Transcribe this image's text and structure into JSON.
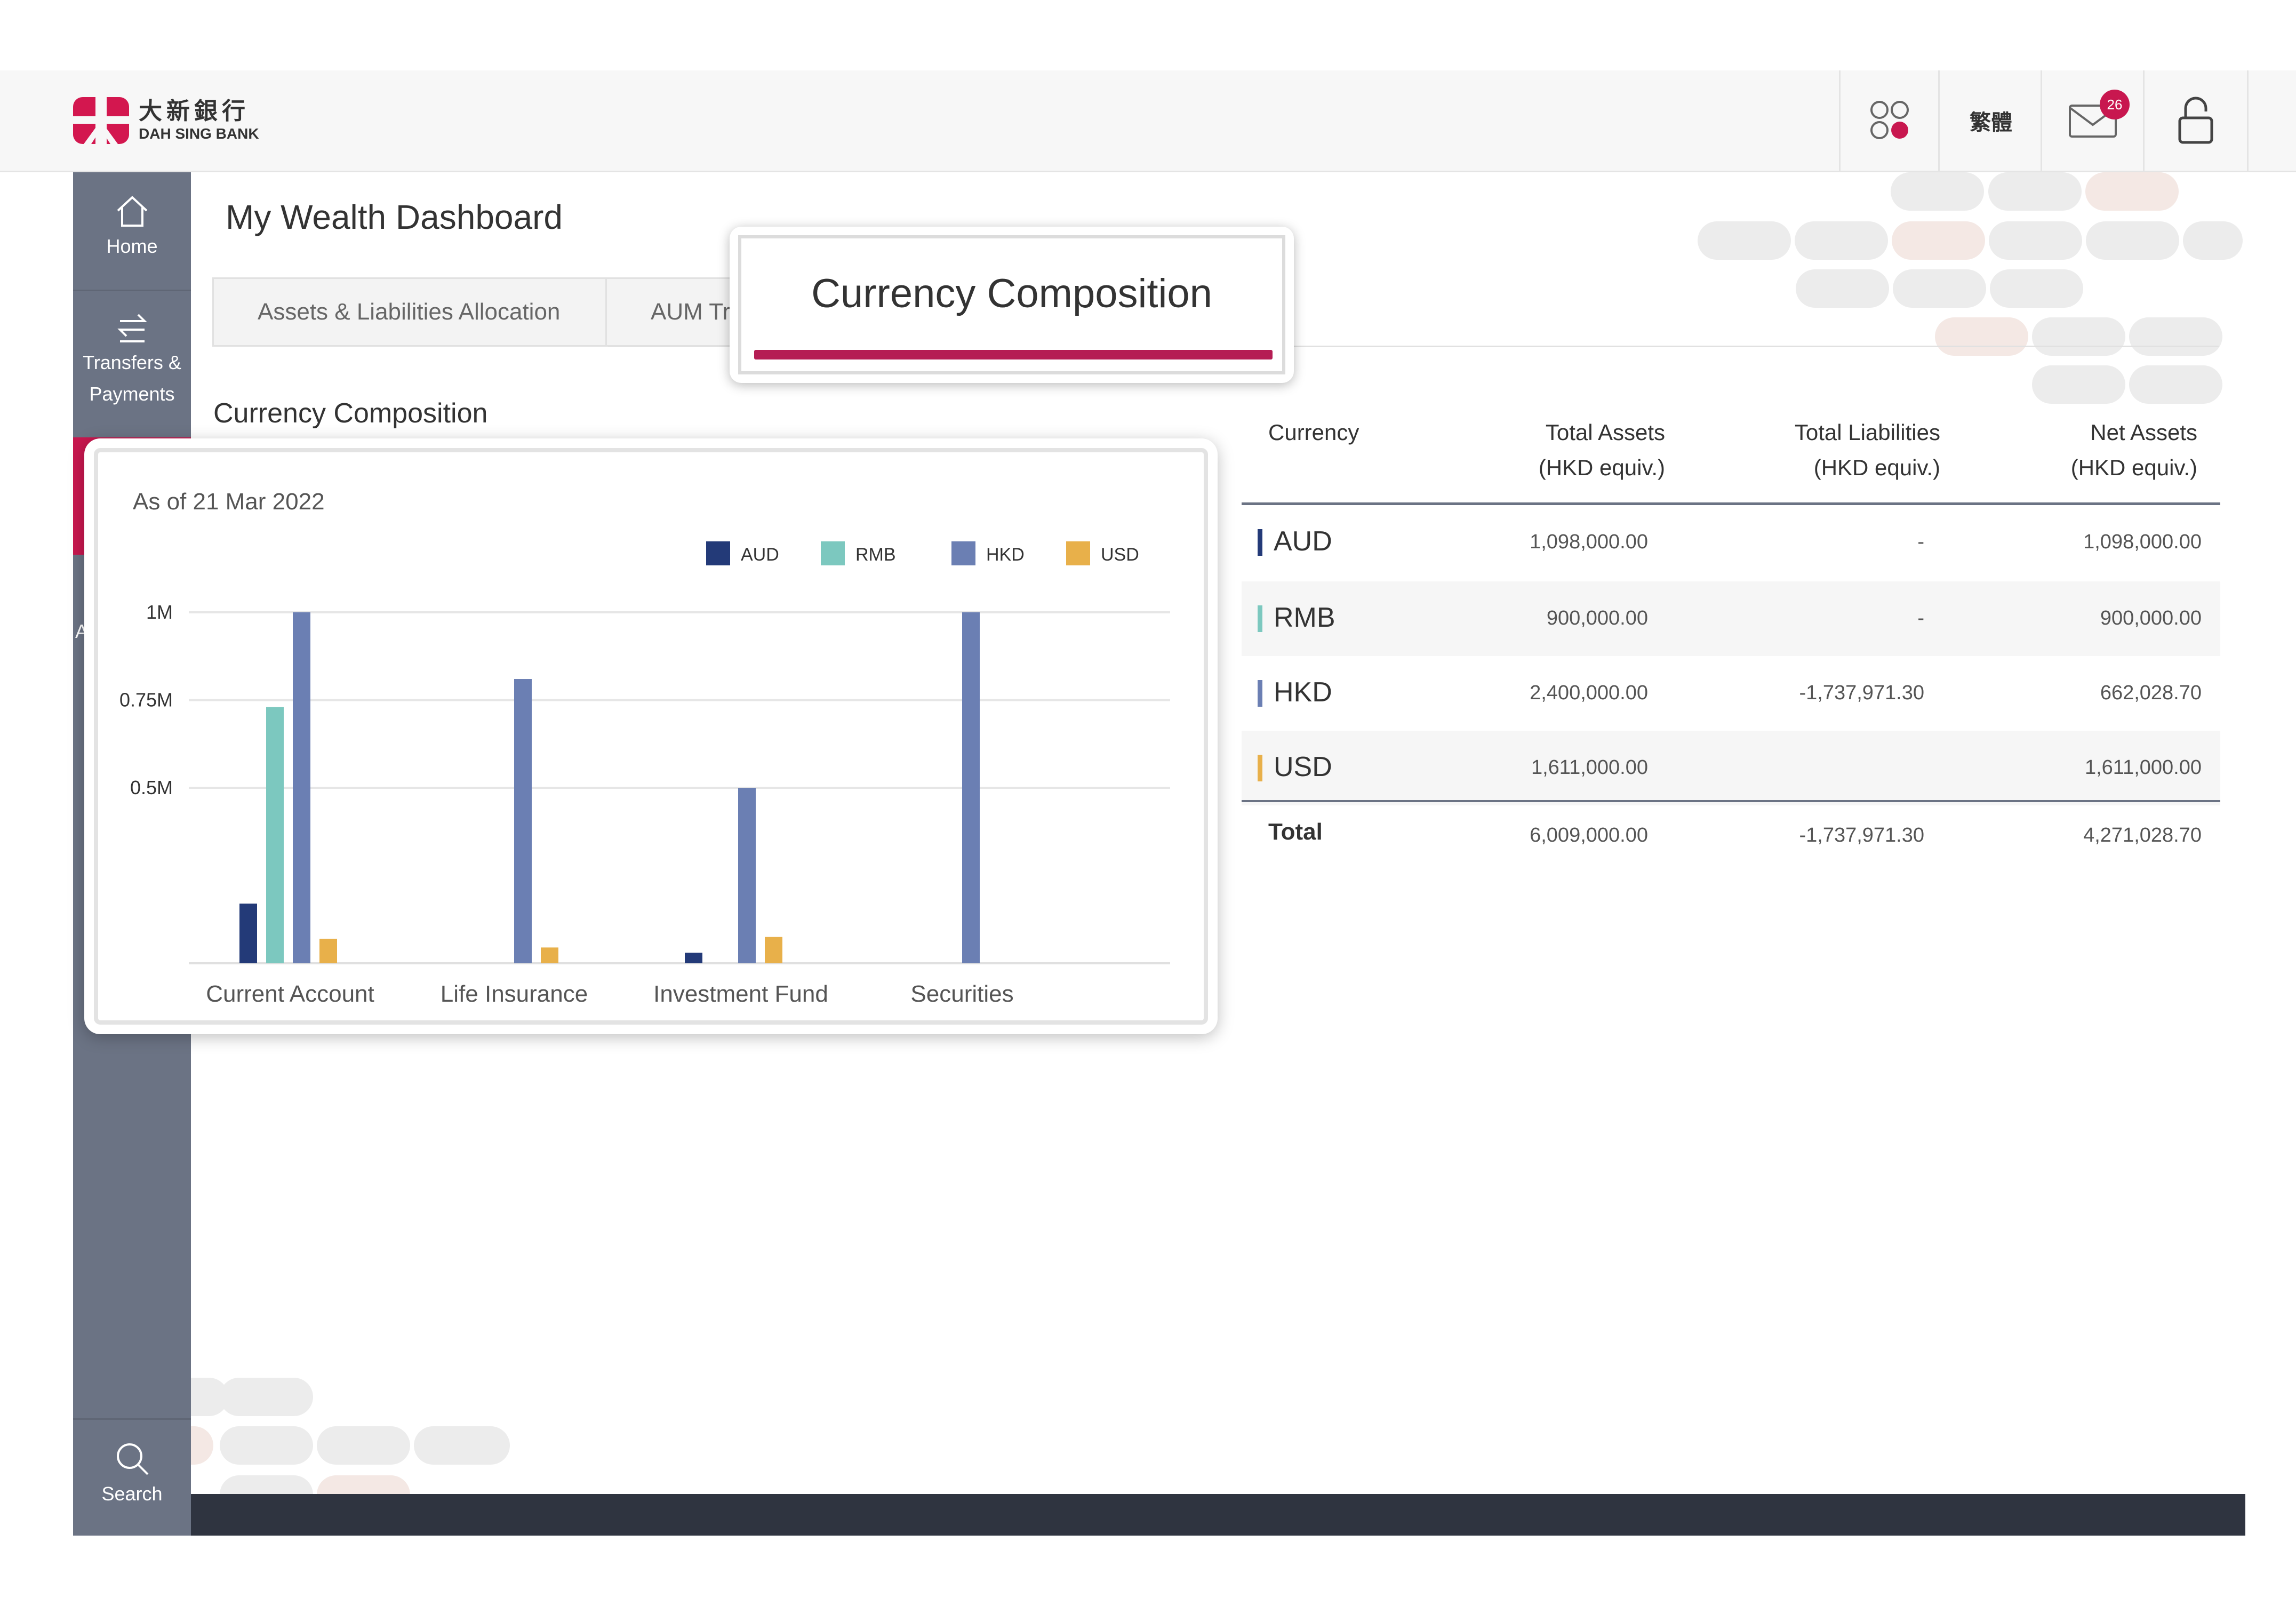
{
  "brand": {
    "name_zh": "大新銀行",
    "name_en": "DAH SING BANK"
  },
  "header": {
    "language_label": "繁體",
    "mail_count": "26"
  },
  "sidebar": {
    "items": [
      {
        "label": "Home",
        "icon": "home-icon"
      },
      {
        "label": "Transfers &\nPayments",
        "icon": "transfer-icon"
      }
    ],
    "search_label": "Search",
    "partial_letter": "A"
  },
  "page": {
    "title": "My Wealth Dashboard",
    "tabs": [
      "Assets & Liabilities Allocation",
      "AUM Tr"
    ],
    "active_tab": "Currency Composition",
    "section_title": "Currency Composition"
  },
  "chart_data": {
    "type": "bar",
    "subtitle": "As of 21 Mar 2022",
    "categories": [
      "Current Account",
      "Life Insurance",
      "Investment Fund",
      "Securities"
    ],
    "series": [
      {
        "name": "AUD",
        "color": "#233a78",
        "values": [
          170000,
          0,
          30000,
          0
        ]
      },
      {
        "name": "RMB",
        "color": "#7cc8bf",
        "values": [
          730000,
          0,
          0,
          0
        ]
      },
      {
        "name": "HKD",
        "color": "#6b7fb3",
        "values": [
          1000000,
          810000,
          500000,
          1000000
        ]
      },
      {
        "name": "USD",
        "color": "#e8b04a",
        "values": [
          70000,
          45000,
          75000,
          0
        ]
      }
    ],
    "yticks": [
      "1M",
      "0.75M",
      "0.5M"
    ],
    "ytick_values": [
      1000000,
      750000,
      500000
    ],
    "ylim": [
      0,
      1000000
    ],
    "legend_position": "top-right",
    "grid": true
  },
  "table": {
    "headers": {
      "currency": "Currency",
      "assets_l1": "Total Assets",
      "assets_l2": "(HKD equiv.)",
      "liab_l1": "Total Liabilities",
      "liab_l2": "(HKD equiv.)",
      "net_l1": "Net Assets",
      "net_l2": "(HKD equiv.)"
    },
    "rows": [
      {
        "code": "AUD",
        "color": "#233a78",
        "assets": "1,098,000.00",
        "liabilities": "-",
        "net": "1,098,000.00"
      },
      {
        "code": "RMB",
        "color": "#7cc8bf",
        "assets": "900,000.00",
        "liabilities": "-",
        "net": "900,000.00"
      },
      {
        "code": "HKD",
        "color": "#6b7fb3",
        "assets": "2,400,000.00",
        "liabilities": "-1,737,971.30",
        "net": "662,028.70"
      },
      {
        "code": "USD",
        "color": "#e8b04a",
        "assets": "1,611,000.00",
        "liabilities": "",
        "net": "1,611,000.00"
      }
    ],
    "total": {
      "label": "Total",
      "assets": "6,009,000.00",
      "liabilities": "-1,737,971.30",
      "net": "4,271,028.70"
    }
  }
}
